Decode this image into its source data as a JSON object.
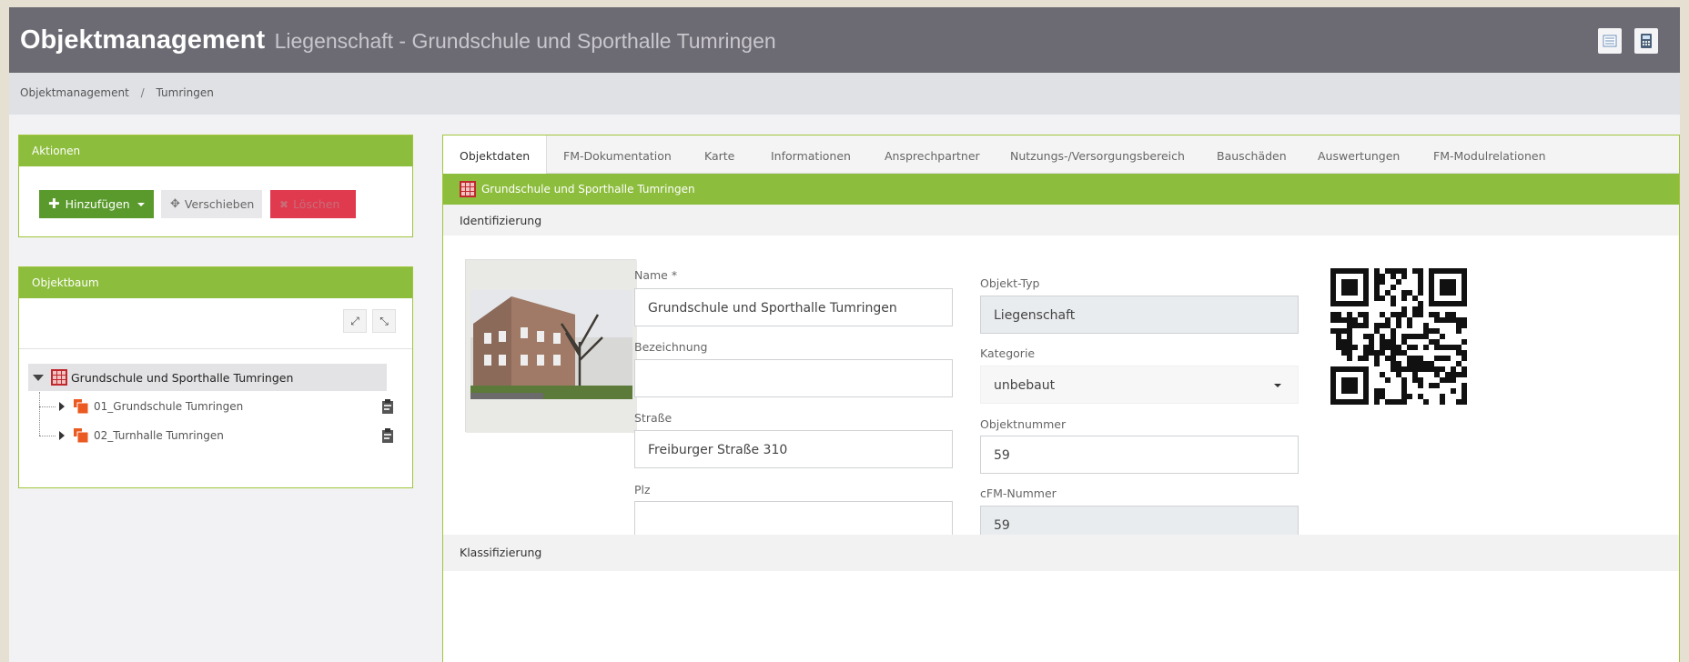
{
  "header": {
    "title": "Objektmanagement",
    "subtitle": "Liegenschaft - Grundschule und Sporthalle Tumringen",
    "icons": [
      "list-view-icon",
      "calculator-icon"
    ]
  },
  "breadcrumb": {
    "items": [
      "Objektmanagement",
      "Tumringen"
    ],
    "separator": "/"
  },
  "actions": {
    "title": "Aktionen",
    "add_label": "Hinzufügen",
    "move_label": "Verschieben",
    "delete_label": "Löschen"
  },
  "tree": {
    "title": "Objektbaum",
    "root": "Grundschule und Sporthalle Tumringen",
    "children": [
      "01_Grundschule Tumringen",
      "02_Turnhalle Tumringen"
    ]
  },
  "tabs": [
    "Objektdaten",
    "FM-Dokumentation",
    "Karte",
    "Informationen",
    "Ansprechpartner",
    "Nutzungs-/Versorgungsbereich",
    "Bauschäden",
    "Auswertungen",
    "FM-Modulrelationen"
  ],
  "object": {
    "heading": "Grundschule und Sporthalle Tumringen",
    "section_identification": "Identifizierung",
    "section_classification": "Klassifizierung"
  },
  "form": {
    "name_label": "Name *",
    "name_value": "Grundschule und Sporthalle Tumringen",
    "bezeichnung_label": "Bezeichnung",
    "bezeichnung_value": "",
    "strasse_label": "Straße",
    "strasse_value": "Freiburger Straße 310",
    "plz_label": "Plz",
    "plz_value": "",
    "objekttyp_label": "Objekt-Typ",
    "objekttyp_value": "Liegenschaft",
    "kategorie_label": "Kategorie",
    "kategorie_value": "unbebaut",
    "objektnummer_label": "Objektnummer",
    "objektnummer_value": "59",
    "cfm_label": "cFM-Nummer",
    "cfm_value": "59"
  },
  "colors": {
    "header_bg": "#6c6a72",
    "accent_green": "#8cbd3c",
    "add_green": "#5a9a2c",
    "delete_red": "#e03a4f",
    "tree_icon_orange": "#ea5a21"
  }
}
